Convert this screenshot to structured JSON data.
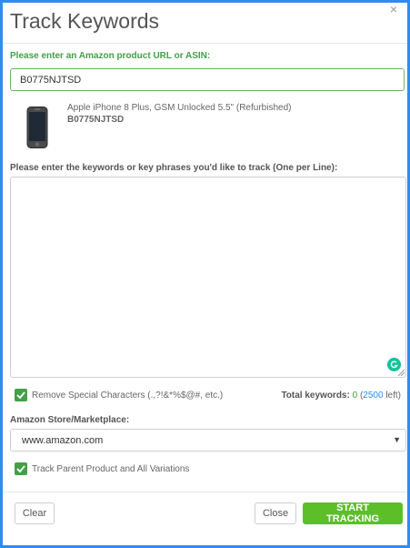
{
  "modal": {
    "title": "Track Keywords",
    "close_glyph": "×"
  },
  "asin_section": {
    "label": "Please enter an Amazon product URL or ASIN:",
    "value": "B0775NJTSD"
  },
  "product": {
    "name": "Apple iPhone 8 Plus, GSM Unlocked 5.5\" (Refurbished)",
    "asin": "B0775NJTSD",
    "thumbnail_icon": "phone-thumbnail"
  },
  "keywords_section": {
    "label": "Please enter the keywords or key phrases you'd like to track (One per Line):",
    "value": ""
  },
  "options": {
    "remove_special": {
      "label": "Remove Special Characters (.,?!&*%$@#, etc.)",
      "checked": true
    },
    "track_parent": {
      "label": "Track Parent Product and All Variations",
      "checked": true
    }
  },
  "totals": {
    "label": "Total keywords:",
    "count": "0",
    "open_paren": "(",
    "left_value": "2500",
    "left_suffix": " left)"
  },
  "marketplace": {
    "label": "Amazon Store/Marketplace:",
    "selected": "www.amazon.com",
    "caret": "▼"
  },
  "footer": {
    "clear_label": "Clear",
    "close_label": "Close",
    "start_label": "START TRACKING"
  },
  "colors": {
    "accent_green": "#43a047",
    "button_green": "#5cbf2a",
    "frame_blue": "#2f8cf0",
    "link_blue": "#2f8cf0"
  }
}
